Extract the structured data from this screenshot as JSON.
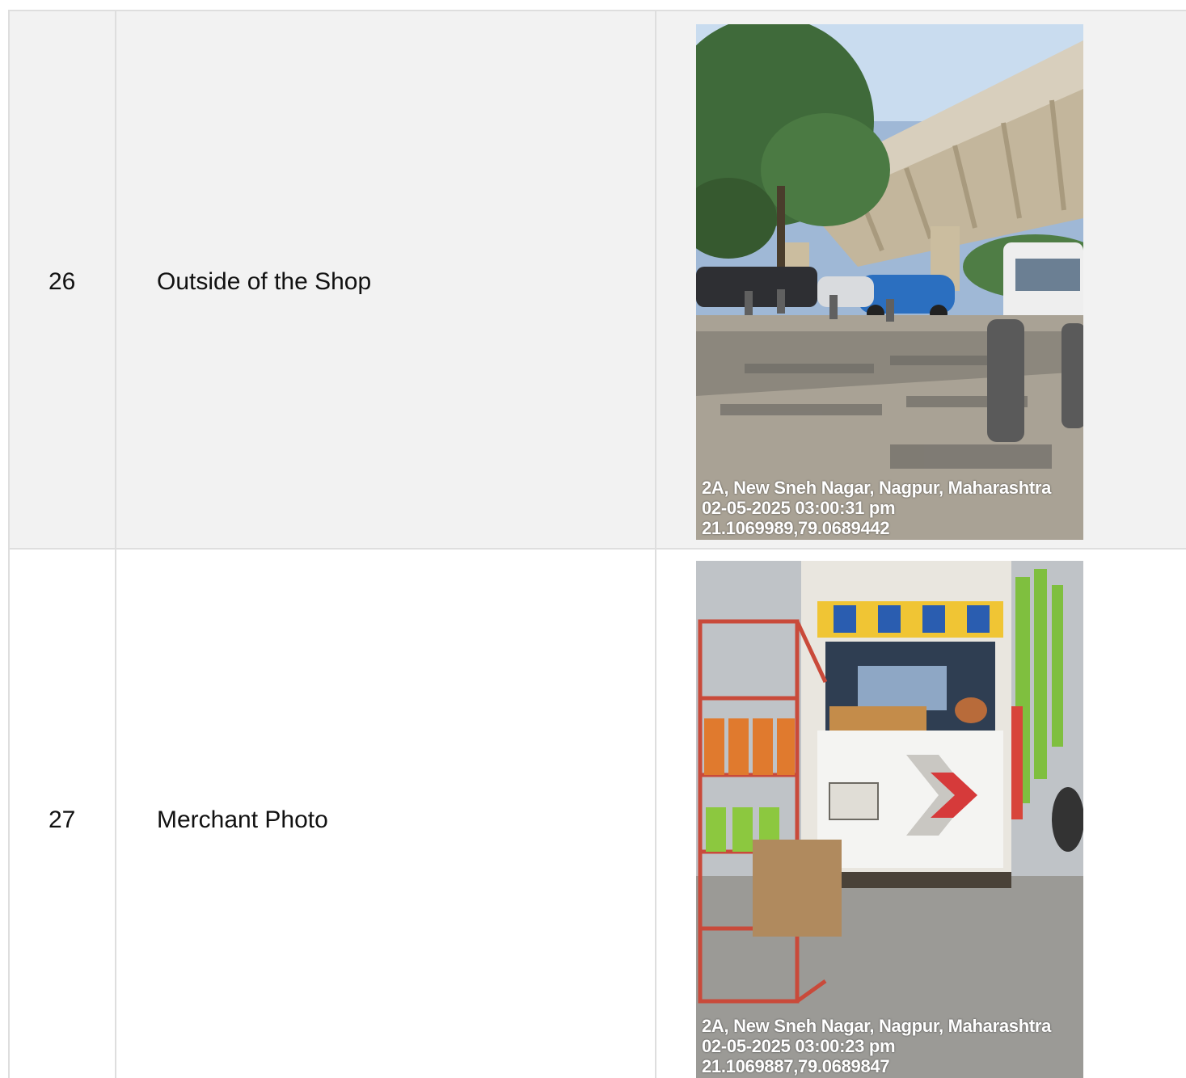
{
  "rows": [
    {
      "number": "26",
      "label": "Outside of the Shop",
      "photo": {
        "icon": "street-flyover-photo",
        "stamp_address": "2A, New Sneh Nagar, Nagpur, Maharashtra",
        "stamp_datetime": "02-05-2025 03:00:31 pm",
        "stamp_coords": "21.1069989,79.0689442"
      }
    },
    {
      "number": "27",
      "label": "Merchant Photo",
      "photo": {
        "icon": "shop-kiosk-photo",
        "stamp_address": "2A, New Sneh Nagar, Nagpur, Maharashtra",
        "stamp_datetime": "02-05-2025 03:00:23 pm",
        "stamp_coords": "21.1069887,79.0689847"
      }
    }
  ],
  "colors": {
    "row_alt": "#f2f2f2",
    "border": "#dedede"
  }
}
